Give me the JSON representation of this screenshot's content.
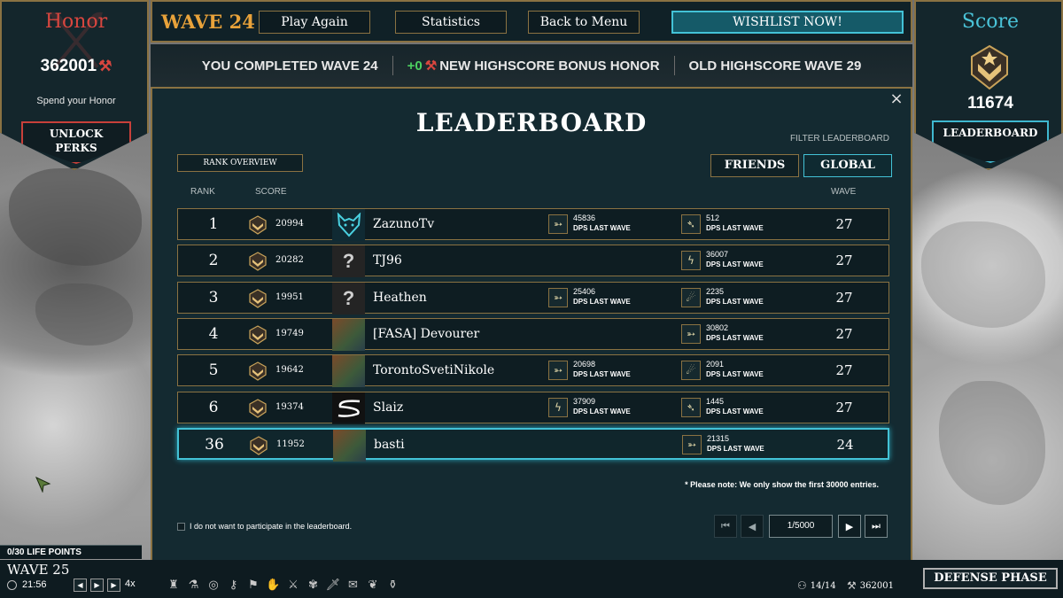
{
  "honor": {
    "title": "Honor",
    "value": "362001",
    "spend_label": "Spend your Honor",
    "unlock_line1": "UNLOCK",
    "unlock_line2": "PERKS"
  },
  "score_panel": {
    "title": "Score",
    "value": "11674",
    "leaderboard_label": "LEADERBOARD"
  },
  "top_bar": {
    "wave": "WAVE 24",
    "play_again": "Play Again",
    "statistics": "Statistics",
    "back_to_menu": "Back to Menu",
    "wishlist": "WISHLIST NOW!"
  },
  "summary": {
    "completed": "YOU COMPLETED WAVE 24",
    "bonus_amount": "+0",
    "bonus_label": "NEW HIGHSCORE BONUS HONOR",
    "old_highscore": "OLD HIGHSCORE WAVE 29"
  },
  "modal": {
    "close_glyph": "×",
    "title": "LEADERBOARD",
    "filter_label": "FILTER LEADERBOARD",
    "rank_overview": "RANK OVERVIEW",
    "friends": "FRIENDS",
    "global": "GLOBAL",
    "col_rank": "RANK",
    "col_score": "SCORE",
    "col_wave": "WAVE",
    "rows": [
      {
        "rank": "1",
        "score": "20994",
        "avatar": "wolf",
        "name": "ZazunoTv",
        "stat1": {
          "icon": "arrow-tower-icon",
          "glyph": "➳",
          "value": "45836",
          "label": "DPS LAST WAVE"
        },
        "stat2": {
          "icon": "spear-tower-icon",
          "glyph": "➴",
          "value": "512",
          "label": "DPS LAST WAVE"
        },
        "wave": "27"
      },
      {
        "rank": "2",
        "score": "20282",
        "avatar": "?",
        "name": "TJ96",
        "stat1": null,
        "stat2": {
          "icon": "lightning-tower-icon",
          "glyph": "ϟ",
          "value": "36007",
          "label": "DPS LAST WAVE"
        },
        "wave": "27"
      },
      {
        "rank": "3",
        "score": "19951",
        "avatar": "?",
        "name": "Heathen",
        "stat1": {
          "icon": "arrow-tower-icon",
          "glyph": "➳",
          "value": "25406",
          "label": "DPS LAST WAVE"
        },
        "stat2": {
          "icon": "fireball-tower-icon",
          "glyph": "☄",
          "value": "2235",
          "label": "DPS LAST WAVE"
        },
        "wave": "27"
      },
      {
        "rank": "4",
        "score": "19749",
        "avatar": "image",
        "name": "[FASA] Devourer",
        "stat1": null,
        "stat2": {
          "icon": "arrow-tower-icon",
          "glyph": "➳",
          "value": "30802",
          "label": "DPS LAST WAVE"
        },
        "wave": "27"
      },
      {
        "rank": "5",
        "score": "19642",
        "avatar": "image",
        "name": "TorontoSvetiNikole",
        "stat1": {
          "icon": "arrow-tower-icon",
          "glyph": "➳",
          "value": "20698",
          "label": "DPS LAST WAVE"
        },
        "stat2": {
          "icon": "fireball-tower-icon",
          "glyph": "☄",
          "value": "2091",
          "label": "DPS LAST WAVE"
        },
        "wave": "27"
      },
      {
        "rank": "6",
        "score": "19374",
        "avatar": "s-logo",
        "name": "Slaiz",
        "stat1": {
          "icon": "lightning-tower-icon",
          "glyph": "ϟ",
          "value": "37909",
          "label": "DPS LAST WAVE"
        },
        "stat2": {
          "icon": "spear-tower-icon",
          "glyph": "➴",
          "value": "1445",
          "label": "DPS LAST WAVE"
        },
        "wave": "27"
      },
      {
        "rank": "36",
        "score": "11952",
        "avatar": "image",
        "name": "basti",
        "stat1": null,
        "stat2": {
          "icon": "arrow-tower-icon",
          "glyph": "➳",
          "value": "21315",
          "label": "DPS LAST WAVE"
        },
        "wave": "24",
        "is_me": true
      }
    ],
    "note": "* Please note: We only show the first 30000 entries.",
    "optout": "I do not want to participate in the leaderboard.",
    "page": "1/5000"
  },
  "hud": {
    "life_points": "0/30 LIFE POINTS",
    "wave": "WAVE 25",
    "timer": "21:56",
    "speed": "4x",
    "population": "14/14",
    "honor": "362001",
    "defense_phase": "DEFENSE PHASE",
    "abilities": [
      "tower-build-icon",
      "flask-icon",
      "shield-round-icon",
      "key-icon",
      "banner-icon",
      "gauntlet-icon",
      "spear-icon",
      "paw-icon",
      "sword-icon",
      "scroll-icon",
      "wing-icon",
      "potion-icon"
    ]
  },
  "colors": {
    "accent_gold": "#8a7242",
    "accent_cyan": "#43c2d6",
    "honor_red": "#d8463f",
    "wave_orange": "#e8a23a",
    "bonus_green": "#4cd160"
  }
}
